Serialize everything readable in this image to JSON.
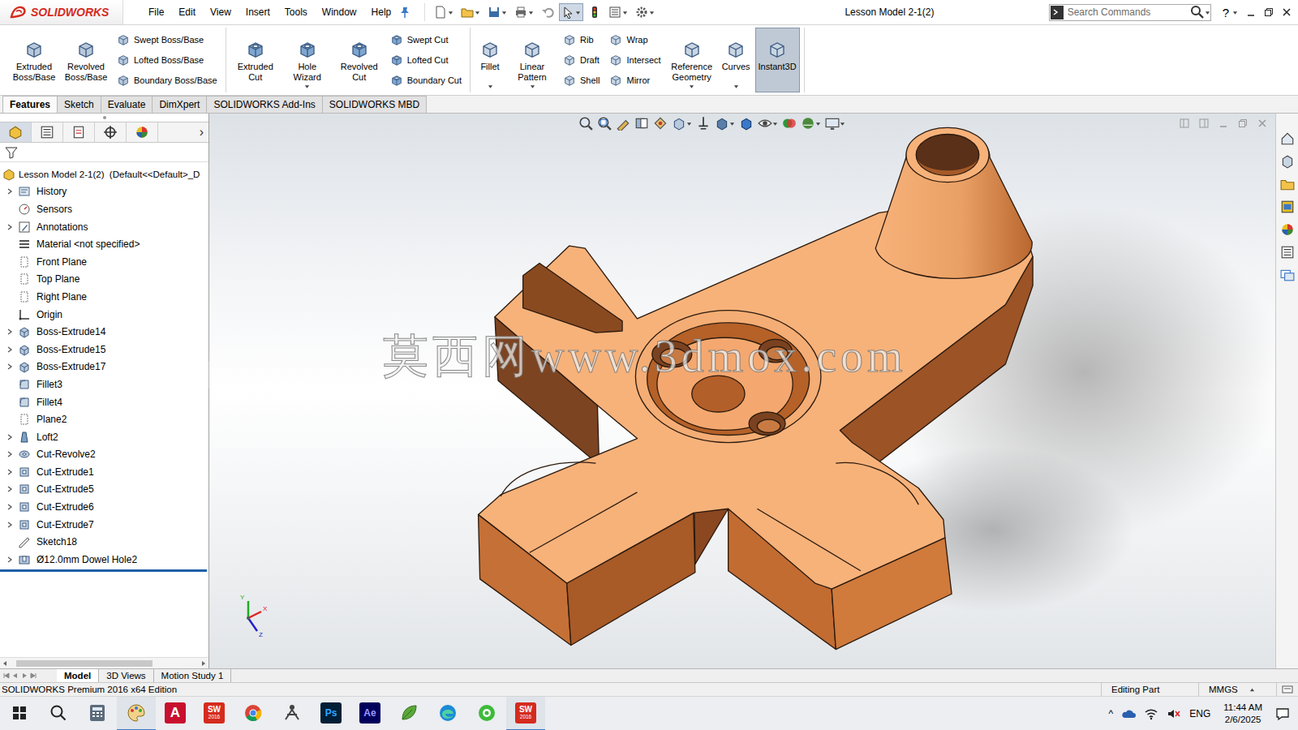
{
  "window": {
    "title": "Lesson Model 2-1(2)"
  },
  "logo": "SOLIDWORKS",
  "menu": [
    "File",
    "Edit",
    "View",
    "Insert",
    "Tools",
    "Window",
    "Help"
  ],
  "quick_tools": [
    {
      "selected": false
    },
    {
      "selected": false
    },
    {
      "selected": false
    },
    {
      "selected": false
    },
    {
      "selected": false
    },
    {
      "selected": true
    },
    {
      "selected": false
    },
    {
      "selected": false
    },
    {
      "selected": false
    }
  ],
  "search": {
    "placeholder": "Search Commands"
  },
  "help": "?",
  "ribbon": {
    "groups": [
      {
        "items": [
          {
            "kind": "large",
            "label": "Extruded Boss/Base",
            "menu": false,
            "selected": false
          },
          {
            "kind": "large",
            "label": "Revolved Boss/Base",
            "menu": false,
            "selected": false
          },
          {
            "kind": "stack",
            "entries": [
              "Swept Boss/Base",
              "Lofted Boss/Base",
              "Boundary Boss/Base"
            ]
          }
        ]
      },
      {
        "items": [
          {
            "kind": "large",
            "label": "Extruded Cut",
            "menu": false,
            "selected": false
          },
          {
            "kind": "large",
            "label": "Hole Wizard",
            "menu": true,
            "selected": false
          },
          {
            "kind": "large",
            "label": "Revolved Cut",
            "menu": false,
            "selected": false
          },
          {
            "kind": "stack",
            "entries": [
              "Swept Cut",
              "Lofted Cut",
              "Boundary Cut"
            ]
          }
        ]
      },
      {
        "items": [
          {
            "kind": "large",
            "label": "Fillet",
            "menu": true,
            "selected": false
          },
          {
            "kind": "large",
            "label": "Linear Pattern",
            "menu": true,
            "selected": false
          },
          {
            "kind": "stack",
            "entries": [
              "Rib",
              "Draft",
              "Shell"
            ]
          },
          {
            "kind": "stack",
            "entries": [
              "Wrap",
              "Intersect",
              "Mirror"
            ]
          },
          {
            "kind": "large",
            "label": "Reference Geometry",
            "menu": true,
            "selected": false
          },
          {
            "kind": "large",
            "label": "Curves",
            "menu": true,
            "selected": false
          },
          {
            "kind": "large",
            "label": "Instant3D",
            "menu": false,
            "selected": true
          }
        ]
      }
    ]
  },
  "command_tabs": [
    {
      "label": "Features",
      "selected": true
    },
    {
      "label": "Sketch",
      "selected": false
    },
    {
      "label": "Evaluate",
      "selected": false
    },
    {
      "label": "DimXpert",
      "selected": false
    },
    {
      "label": "SOLIDWORKS Add-Ins",
      "selected": false
    },
    {
      "label": "SOLIDWORKS MBD",
      "selected": false
    }
  ],
  "tree": {
    "panel_tabs": [
      {
        "selected": true
      },
      {
        "selected": false
      },
      {
        "selected": false
      },
      {
        "selected": false
      },
      {
        "selected": false
      }
    ],
    "more": "›",
    "root": "Lesson Model 2-1(2)  (Default<<Default>_D",
    "items": [
      {
        "label": "History",
        "kind": "history",
        "expandable": true
      },
      {
        "label": "Sensors",
        "kind": "sensors",
        "expandable": false
      },
      {
        "label": "Annotations",
        "kind": "annotations",
        "expandable": true
      },
      {
        "label": "Material <not specified>",
        "kind": "material",
        "expandable": false
      },
      {
        "label": "Front Plane",
        "kind": "plane",
        "expandable": false
      },
      {
        "label": "Top Plane",
        "kind": "plane",
        "expandable": false
      },
      {
        "label": "Right Plane",
        "kind": "plane",
        "expandable": false
      },
      {
        "label": "Origin",
        "kind": "origin",
        "expandable": false
      },
      {
        "label": "Boss-Extrude14",
        "kind": "extrude",
        "expandable": true
      },
      {
        "label": "Boss-Extrude15",
        "kind": "extrude",
        "expandable": true
      },
      {
        "label": "Boss-Extrude17",
        "kind": "extrude",
        "expandable": true
      },
      {
        "label": "Fillet3",
        "kind": "fillet",
        "expandable": false
      },
      {
        "label": "Fillet4",
        "kind": "fillet",
        "expandable": false
      },
      {
        "label": "Plane2",
        "kind": "plane",
        "expandable": false
      },
      {
        "label": "Loft2",
        "kind": "loft",
        "expandable": true
      },
      {
        "label": "Cut-Revolve2",
        "kind": "revolve",
        "expandable": true
      },
      {
        "label": "Cut-Extrude1",
        "kind": "cut",
        "expandable": true
      },
      {
        "label": "Cut-Extrude5",
        "kind": "cut",
        "expandable": true
      },
      {
        "label": "Cut-Extrude6",
        "kind": "cut",
        "expandable": true
      },
      {
        "label": "Cut-Extrude7",
        "kind": "cut",
        "expandable": true
      },
      {
        "label": "Sketch18",
        "kind": "sketch",
        "expandable": false
      },
      {
        "label": "Ø12.0mm Dowel Hole2",
        "kind": "hole",
        "expandable": true
      }
    ]
  },
  "viewport": {
    "watermark": "莫西网www.3dmox.com",
    "triad": {
      "x": "X",
      "y": "Y",
      "z": "Z"
    }
  },
  "bottom_tabs": [
    {
      "label": "Model",
      "selected": true
    },
    {
      "label": "3D Views",
      "selected": false
    },
    {
      "label": "Motion Study 1",
      "selected": false
    }
  ],
  "status_bar": {
    "edition": "SOLIDWORKS Premium 2016 x64 Edition",
    "mode": "Editing Part",
    "units": "MMGS"
  },
  "taskbar": {
    "apps": [
      {
        "kind": "calculator",
        "running": false
      },
      {
        "kind": "paint",
        "running": true
      },
      {
        "kind": "autodesk",
        "glyph": "A",
        "running": false
      },
      {
        "kind": "solidworks",
        "glyph": "SW",
        "badge": "2016",
        "running": false
      },
      {
        "kind": "chrome",
        "running": false
      },
      {
        "kind": "network",
        "running": false
      },
      {
        "kind": "photoshop",
        "glyph": "Ps",
        "running": false
      },
      {
        "kind": "aftereffects",
        "glyph": "Ae",
        "running": false
      },
      {
        "kind": "leaf",
        "running": false
      },
      {
        "kind": "edge",
        "running": false
      },
      {
        "kind": "wechat",
        "running": false
      },
      {
        "kind": "solidworks",
        "glyph": "SW",
        "badge": "2016",
        "running": true
      }
    ],
    "tray": {
      "expand": "^",
      "language": "ENG",
      "time": "11:44 AM",
      "date": "2/6/2025"
    }
  }
}
